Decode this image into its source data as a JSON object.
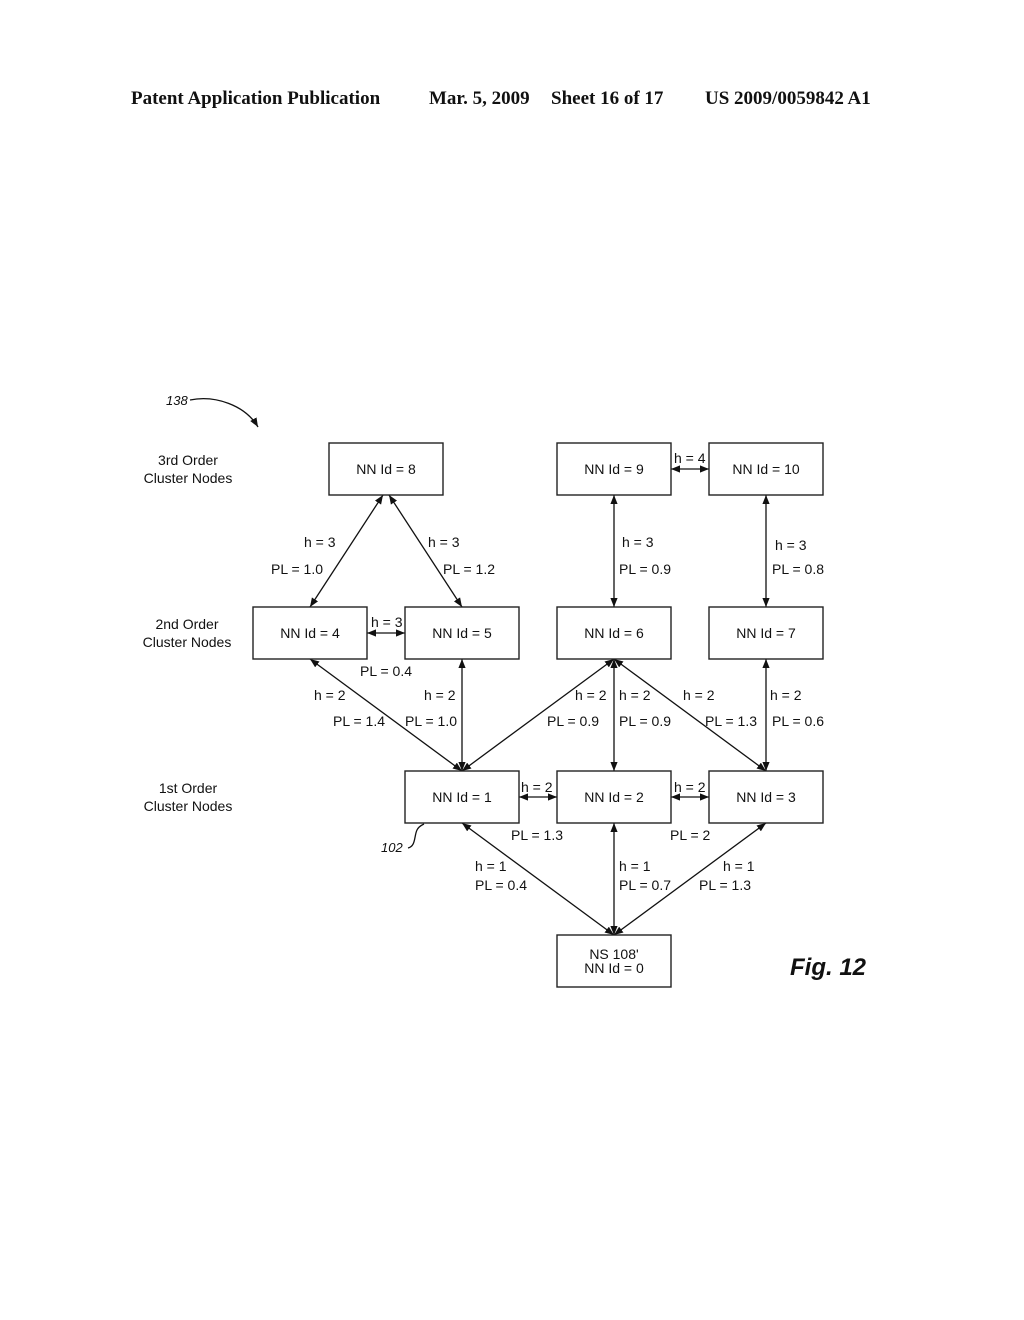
{
  "header": {
    "publication": "Patent Application Publication",
    "date": "Mar. 5, 2009",
    "sheet": "Sheet 16 of 17",
    "number": "US 2009/0059842 A1"
  },
  "figure": {
    "label": "Fig. 12",
    "reference": "138",
    "node_reference": "102"
  },
  "row_labels": [
    {
      "id": "order3",
      "line1": "3rd Order",
      "line2": "Cluster Nodes"
    },
    {
      "id": "order2",
      "line1": "2nd Order",
      "line2": "Cluster Nodes"
    },
    {
      "id": "order1",
      "line1": "1st Order",
      "line2": "Cluster Nodes"
    }
  ],
  "nodes": [
    {
      "id": 0,
      "lines": [
        "NS 108'",
        "NN Id = 0"
      ],
      "order": 0
    },
    {
      "id": 1,
      "lines": [
        "NN Id = 1"
      ],
      "order": 1
    },
    {
      "id": 2,
      "lines": [
        "NN Id = 2"
      ],
      "order": 1
    },
    {
      "id": 3,
      "lines": [
        "NN Id = 3"
      ],
      "order": 1
    },
    {
      "id": 4,
      "lines": [
        "NN Id = 4"
      ],
      "order": 2
    },
    {
      "id": 5,
      "lines": [
        "NN Id = 5"
      ],
      "order": 2
    },
    {
      "id": 6,
      "lines": [
        "NN Id = 6"
      ],
      "order": 2
    },
    {
      "id": 7,
      "lines": [
        "NN Id = 7"
      ],
      "order": 2
    },
    {
      "id": 8,
      "lines": [
        "NN Id = 8"
      ],
      "order": 3
    },
    {
      "id": 9,
      "lines": [
        "NN Id = 9"
      ],
      "order": 3
    },
    {
      "id": 10,
      "lines": [
        "NN Id = 10"
      ],
      "order": 3
    }
  ],
  "edges": [
    {
      "from": 0,
      "to": 1,
      "h": "h = 1",
      "pl": "PL = 0.4",
      "bidirectional": true
    },
    {
      "from": 0,
      "to": 2,
      "h": "h = 1",
      "pl": "PL = 0.7",
      "bidirectional": true
    },
    {
      "from": 0,
      "to": 3,
      "h": "h = 1",
      "pl": "PL = 1.3",
      "bidirectional": true
    },
    {
      "from": 1,
      "to": 2,
      "h": "h = 2",
      "pl": "PL = 1.3",
      "bidirectional": true
    },
    {
      "from": 2,
      "to": 3,
      "h": "h = 2",
      "pl": "PL = 2",
      "bidirectional": true
    },
    {
      "from": 1,
      "to": 4,
      "h": "h = 2",
      "pl": "PL = 1.4",
      "bidirectional": true
    },
    {
      "from": 1,
      "to": 5,
      "h": "h = 2",
      "pl": "PL = 1.0",
      "bidirectional": true
    },
    {
      "from": 1,
      "to": 6,
      "h": "h = 2",
      "pl": "PL = 0.9",
      "bidirectional": true
    },
    {
      "from": 2,
      "to": 6,
      "h": "h = 2",
      "pl": "PL = 0.9",
      "bidirectional": true
    },
    {
      "from": 3,
      "to": 6,
      "h": "h = 2",
      "pl": "PL = 1.3",
      "bidirectional": true
    },
    {
      "from": 3,
      "to": 7,
      "h": "h = 2",
      "pl": "PL = 0.6",
      "bidirectional": true
    },
    {
      "from": 4,
      "to": 5,
      "h": "h = 3",
      "pl": "PL = 0.4",
      "bidirectional": true
    },
    {
      "from": 4,
      "to": 8,
      "h": "h = 3",
      "pl": "PL = 1.0",
      "bidirectional": true
    },
    {
      "from": 5,
      "to": 8,
      "h": "h = 3",
      "pl": "PL = 1.2",
      "bidirectional": true
    },
    {
      "from": 6,
      "to": 9,
      "h": "h = 3",
      "pl": "PL = 0.9",
      "bidirectional": true
    },
    {
      "from": 7,
      "to": 10,
      "h": "h = 3",
      "pl": "PL = 0.8",
      "bidirectional": true
    },
    {
      "from": 9,
      "to": 10,
      "h": "h = 4",
      "pl": "",
      "bidirectional": true
    }
  ]
}
